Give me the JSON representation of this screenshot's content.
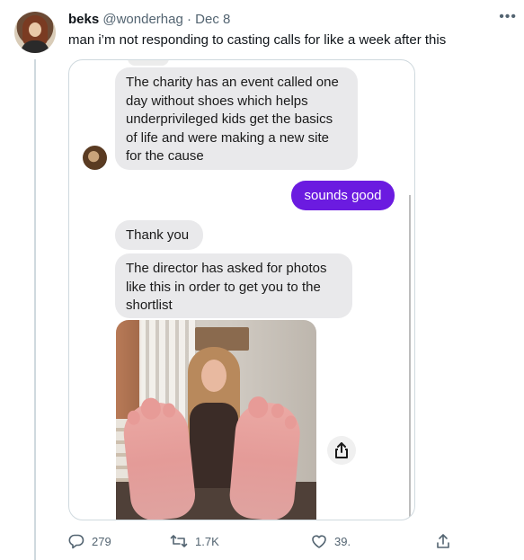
{
  "tweet": {
    "display_name": "beks",
    "handle": "@wonderhag",
    "separator": "·",
    "date": "Dec 8",
    "text": "man i’m not responding to casting calls for like a week after this",
    "more_icon": "more-options-icon"
  },
  "screenshot": {
    "messages": [
      {
        "side": "received",
        "text": "The charity has an event called one day without shoes which helps underprivileged kids get the basics of life and were making a new site for the cause"
      },
      {
        "side": "sent",
        "text": "sounds good"
      },
      {
        "side": "received",
        "text": "Thank you"
      },
      {
        "side": "received",
        "text": "The director has asked for photos like this in order to get you to the shortlist"
      }
    ],
    "sent_bubble_color": "#6b1be0",
    "received_bubble_color": "#e9e9eb",
    "photo_share_icon": "share-upload-icon"
  },
  "actions": {
    "reply_count": "279",
    "retweet_count": "1.7K",
    "like_count": "39.",
    "reply_icon": "reply-icon",
    "retweet_icon": "retweet-icon",
    "like_icon": "heart-icon",
    "share_icon": "share-icon"
  }
}
